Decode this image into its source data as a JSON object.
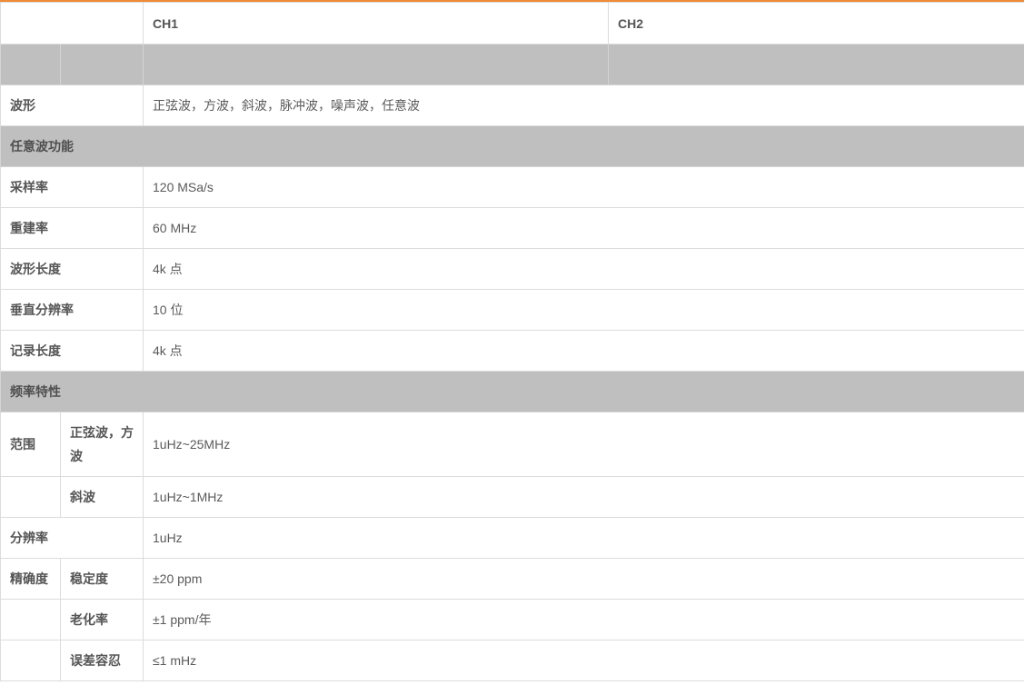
{
  "header": {
    "ch1": "CH1",
    "ch2": "CH2"
  },
  "rows": {
    "waveform": {
      "label": "波形",
      "value": "正弦波，方波，斜波，脉冲波，噪声波，任意波"
    },
    "arb_section": {
      "label": "任意波功能"
    },
    "sample_rate": {
      "label": "采样率",
      "value": "120 MSa/s"
    },
    "rebuild_rate": {
      "label": "重建率",
      "value": "60 MHz"
    },
    "wave_length": {
      "label": "波形长度",
      "value": "4k 点"
    },
    "vertical_res": {
      "label": "垂直分辨率",
      "value": "10 位"
    },
    "record_length": {
      "label": "记录长度",
      "value": "4k 点"
    },
    "freq_section": {
      "label": "频率特性"
    },
    "range": {
      "label": "范围",
      "sine_square": {
        "label": "正弦波，方波",
        "value": "1uHz~25MHz"
      },
      "ramp": {
        "label": "斜波",
        "value": "1uHz~1MHz"
      }
    },
    "resolution": {
      "label": "分辨率",
      "value": "1uHz"
    },
    "accuracy": {
      "label": "精确度",
      "stability": {
        "label": "稳定度",
        "value": "±20 ppm"
      },
      "aging": {
        "label": "老化率",
        "value": "±1 ppm/年"
      },
      "tolerance": {
        "label": "误差容忍",
        "value": "≤1 mHz"
      }
    }
  },
  "colors": {
    "accent": "#f08a35",
    "section_bg": "#bfbfbf",
    "border": "#dcdcdc"
  }
}
